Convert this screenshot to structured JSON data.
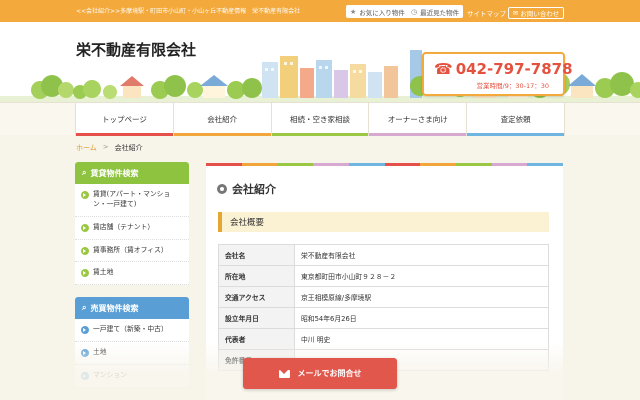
{
  "topbar": {
    "description": "<<会社紹介>>多摩境駅・町田市小山町・小山ヶ丘不動産情報　栄不動産有限会社",
    "favorites_label": "お気に入り物件",
    "recent_label": "最近見た物件",
    "sitemap_label": "サイトマップ",
    "contact_label": "お問い合わせ"
  },
  "header": {
    "logo": "栄不動産有限会社",
    "phone": "042-797-7878",
    "hours": "営業時間/9：30-17：30"
  },
  "nav": [
    {
      "label": "トップページ",
      "color": "#e6504a"
    },
    {
      "label": "会社紹介",
      "color": "#f2a53a"
    },
    {
      "label": "相続・空き家相談",
      "color": "#9ac844"
    },
    {
      "label": "オーナーさま向け",
      "color": "#d7a8d0"
    },
    {
      "label": "査定依頼",
      "color": "#6fb5e2"
    }
  ],
  "breadcrumb": {
    "home": "ホーム",
    "sep": ">",
    "current": "会社紹介"
  },
  "sidebar": {
    "rent_title": "賃貸物件検索",
    "rent_color": "#8ec33f",
    "rent_items": [
      "賃貸(アパート・マンション・一戸建て)",
      "賃店舗（テナント）",
      "賃事務所（賃オフィス）",
      "賃土地"
    ],
    "sale_title": "売買物件検索",
    "sale_color": "#5a9ed6",
    "sale_items": [
      "一戸建て（新築・中古）",
      "土地",
      "マンション"
    ]
  },
  "main": {
    "title": "会社紹介",
    "section_title": "会社概要",
    "rows": [
      {
        "label": "会社名",
        "value": "栄不動産有限会社"
      },
      {
        "label": "所在地",
        "value": "東京都町田市小山町９２８－２"
      },
      {
        "label": "交通アクセス",
        "value": "京王相模原線/多摩境駅"
      },
      {
        "label": "設立年月日",
        "value": "昭和54年6月26日"
      },
      {
        "label": "代表者",
        "value": "中川 明史"
      },
      {
        "label": "免許番号",
        "value": ""
      }
    ]
  },
  "mail_button": "メールでお問合せ"
}
